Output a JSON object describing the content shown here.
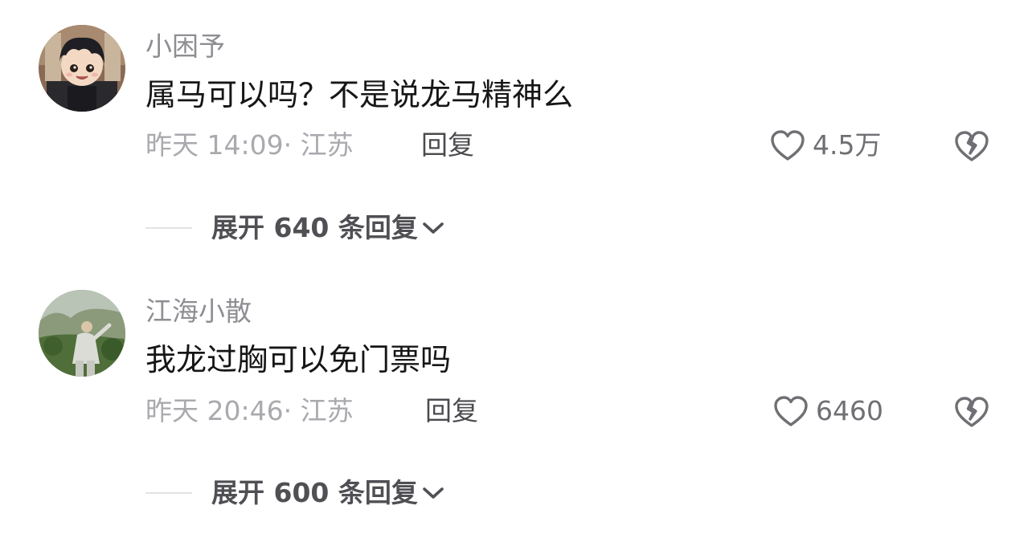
{
  "comments": [
    {
      "username": "小困予",
      "text": "属马可以吗？不是说龙马精神么",
      "time_location": "昨天 14:09· 江苏",
      "reply_label": "回复",
      "likes": "4.5万",
      "expand_label": "展开 640 条回复"
    },
    {
      "username": "江海小散",
      "text": "我龙过胸可以免门票吗",
      "time_location": "昨天 20:46· 江苏",
      "reply_label": "回复",
      "likes": "6460",
      "expand_label": "展开 600 条回复"
    }
  ],
  "icons": {
    "like": "heart-outline-icon",
    "dislike": "broken-heart-icon",
    "expand": "chevron-down-icon"
  },
  "colors": {
    "username": "#8e8e93",
    "text": "#161616",
    "meta": "#a9a9ae",
    "icon": "#6f6f74"
  }
}
